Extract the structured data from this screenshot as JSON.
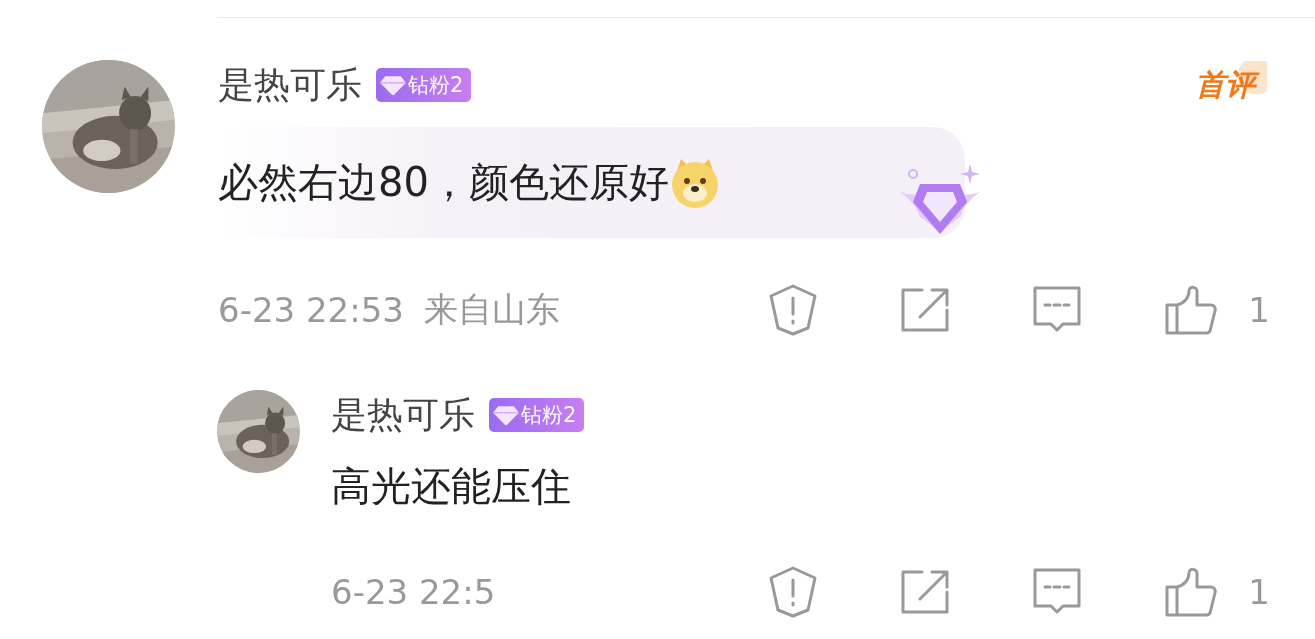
{
  "comments": [
    {
      "kind": "main",
      "author": {
        "name": "是热可乐",
        "badge": "钻粉2"
      },
      "tag": "首评",
      "text": "必然右边80，颜色还原好",
      "time": "6-23 22:53",
      "location": "来自山东",
      "likes": "1"
    },
    {
      "kind": "reply",
      "author": {
        "name": "是热可乐",
        "badge": "钻粉2"
      },
      "text": "高光还能压住",
      "time": "6-23 22:5",
      "likes": "1"
    }
  ]
}
